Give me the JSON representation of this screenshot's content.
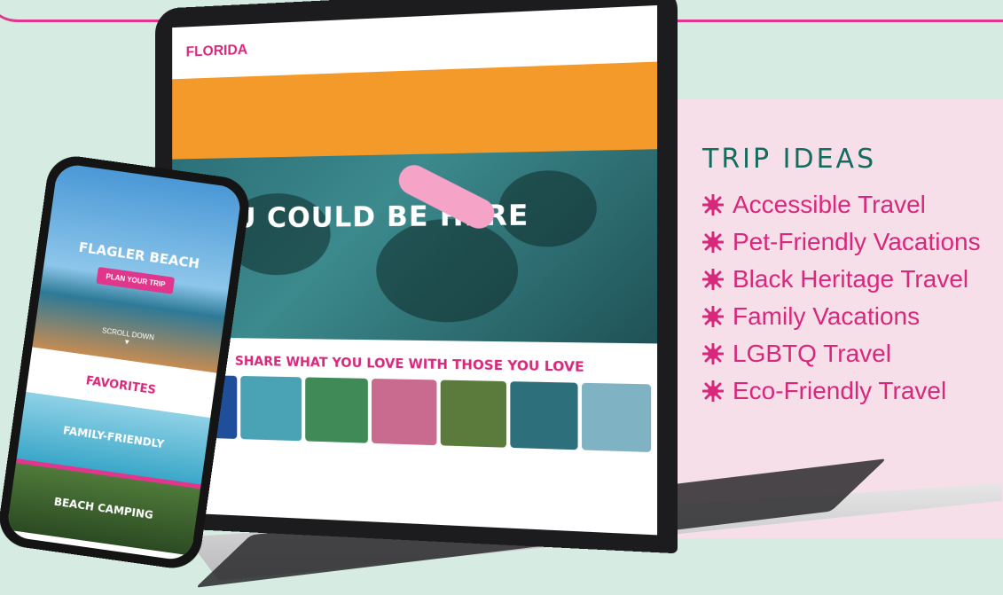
{
  "colors": {
    "background": "#d6ece2",
    "panel": "#f7dfe9",
    "accent": "#d8287c",
    "teal": "#156b5e",
    "orange": "#f49a2a"
  },
  "trip_ideas": {
    "title": "TRIP IDEAS",
    "bullet_icon": "starburst-icon",
    "items": [
      {
        "label": "Accessible Travel"
      },
      {
        "label": "Pet-Friendly Vacations"
      },
      {
        "label": "Black Heritage Travel"
      },
      {
        "label": "Family Vacations"
      },
      {
        "label": "LGBTQ Travel"
      },
      {
        "label": "Eco-Friendly Travel"
      }
    ]
  },
  "laptop_site": {
    "logo": "FLORIDA",
    "hero_title": "YOU COULD BE HERE",
    "share_heading": "SHARE WHAT YOU LOVE WITH THOSE YOU LOVE"
  },
  "phone_site": {
    "hero_title": "FLAGLER BEACH",
    "cta": "PLAN YOUR TRIP",
    "scroll_hint": "SCROLL DOWN",
    "favorites_heading": "FAVORITES",
    "cards": [
      {
        "label": "FAMILY-FRIENDLY"
      },
      {
        "label": "BEACH CAMPING"
      }
    ]
  }
}
